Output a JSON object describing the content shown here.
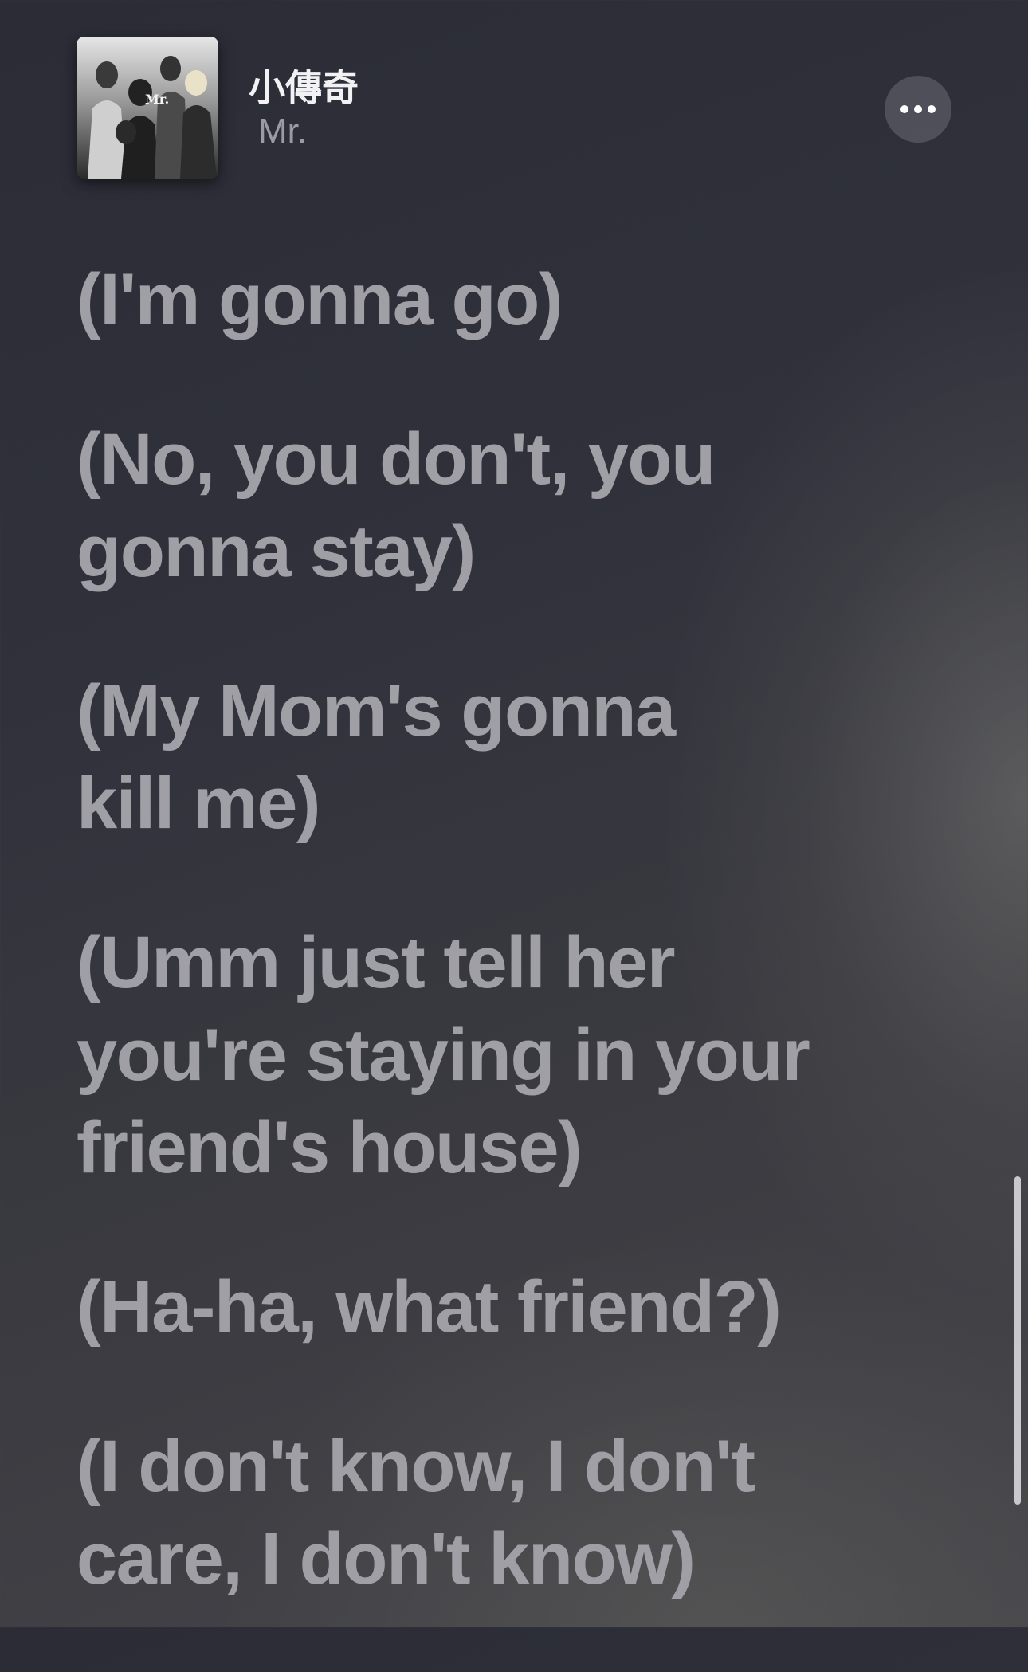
{
  "header": {
    "song_title": "小傳奇",
    "artist": "Mr.",
    "album_art_text": "Mr.",
    "more_button_icon": "ellipsis-icon"
  },
  "lyrics": [
    "(I'm gonna go)",
    "(No, you don't, you\ngonna stay)",
    "(My Mom's gonna\nkill me)",
    "(Umm just tell her\nyou're staying in your\nfriend's house)",
    "(Ha-ha, what friend?)",
    "(I don't know, I don't\ncare, I don't know)"
  ],
  "colors": {
    "lyric_text": "#a09fa6",
    "title_text": "#f2f2f4",
    "artist_text": "#9b9ba3",
    "background": "#30313b"
  }
}
